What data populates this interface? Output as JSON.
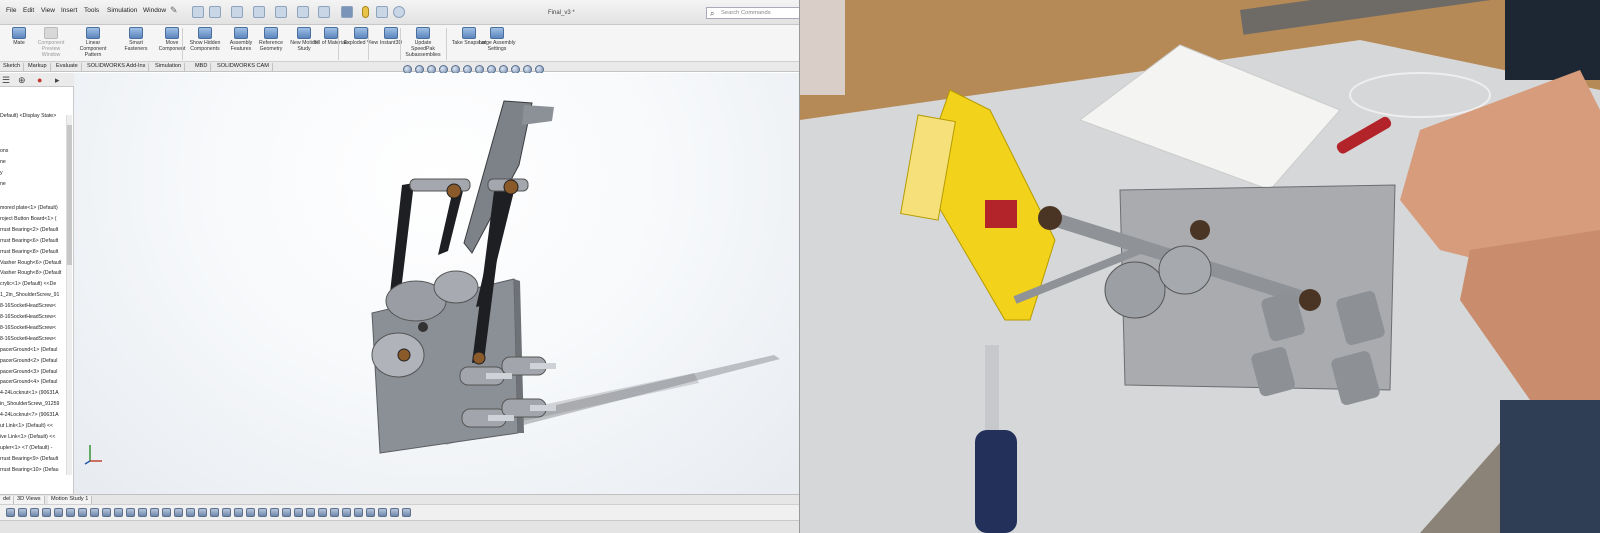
{
  "menu": {
    "items": [
      "File",
      "Edit",
      "View",
      "Insert",
      "Tools",
      "Simulation",
      "Window"
    ],
    "pin_icon": "pin-icon"
  },
  "document_title": "Final_v3 *",
  "search": {
    "placeholder": "Search Commands",
    "icon": "search-icon"
  },
  "ribbon": [
    {
      "label": "Mate",
      "dim": false
    },
    {
      "label": "Component Preview Window",
      "dim": true
    },
    {
      "label": "Linear Component Pattern",
      "dim": false
    },
    {
      "label": "Smart Fasteners",
      "dim": false
    },
    {
      "label": "Move Component",
      "dim": false
    },
    {
      "label": "Show Hidden Components",
      "dim": false
    },
    {
      "label": "Assembly Features",
      "dim": false
    },
    {
      "label": "Reference Geometry",
      "dim": false
    },
    {
      "label": "New Motion Study",
      "dim": false
    },
    {
      "label": "Bill of Materials",
      "dim": false
    },
    {
      "label": "Exploded View",
      "dim": false
    },
    {
      "label": "Instant3D",
      "dim": false
    },
    {
      "label": "Update SpeedPak Subassemblies",
      "dim": false
    },
    {
      "label": "Take Snapshot",
      "dim": false
    },
    {
      "label": "Large Assembly Settings",
      "dim": false
    }
  ],
  "command_tabs": [
    "Sketch",
    "Markup",
    "Evaluate",
    "SOLIDWORKS Add-Ins",
    "Simulation",
    "MBD",
    "SOLIDWORKS CAM"
  ],
  "panel": {
    "tab_icons": [
      "feature-manager-icon",
      "configuration-manager-icon",
      "dimxpert-icon",
      "display-manager-icon"
    ],
    "header": "Default) <Display State>",
    "top_rows": [
      "ons",
      "ne",
      "y",
      "ne"
    ],
    "tree": [
      "mored plate<1> (Default)",
      "roject Button Board<1> (",
      "rrust Bearing<2> (Default",
      "rrust Bearing<6> (Default",
      "rrust Bearing<8> (Default",
      "Vasher Rough<6> (Default",
      "Vasher Rough<8> (Default",
      "crylic<1> (Default) <<De",
      "1_2in_ShoulderScrew_91",
      "8-16SocketHeadScrew<",
      "8-16SocketHeadScrew<",
      "8-16SocketHeadScrew<",
      "8-16SocketHeadScrew<",
      "pacerGround<1> (Defaul",
      "pacerGround<2> (Defaul",
      "pacerGround<3> (Defaul",
      "pacerGround<4> (Defaul",
      "4-24Locknut<1> (90631A",
      "in_ShoulderScrew_91259",
      "4-24Locknut<7> (90631A",
      "ut Link<1> (Default) <<",
      "ive Link<1> (Default) <<",
      "upler<1> <7 (Default) -",
      "rrust Bearing<9> (Default",
      "rrust Bearing<10> (Defau"
    ]
  },
  "bottom_tabs": [
    "del",
    "3D Views",
    "Motion Study 1"
  ],
  "colors": {
    "ribbon_icon": "#5d86bd",
    "model_plate": "#8b8f96",
    "model_link": "#1e1f22",
    "printed_part": "#f2d21b",
    "table": "#d6d7d9"
  }
}
